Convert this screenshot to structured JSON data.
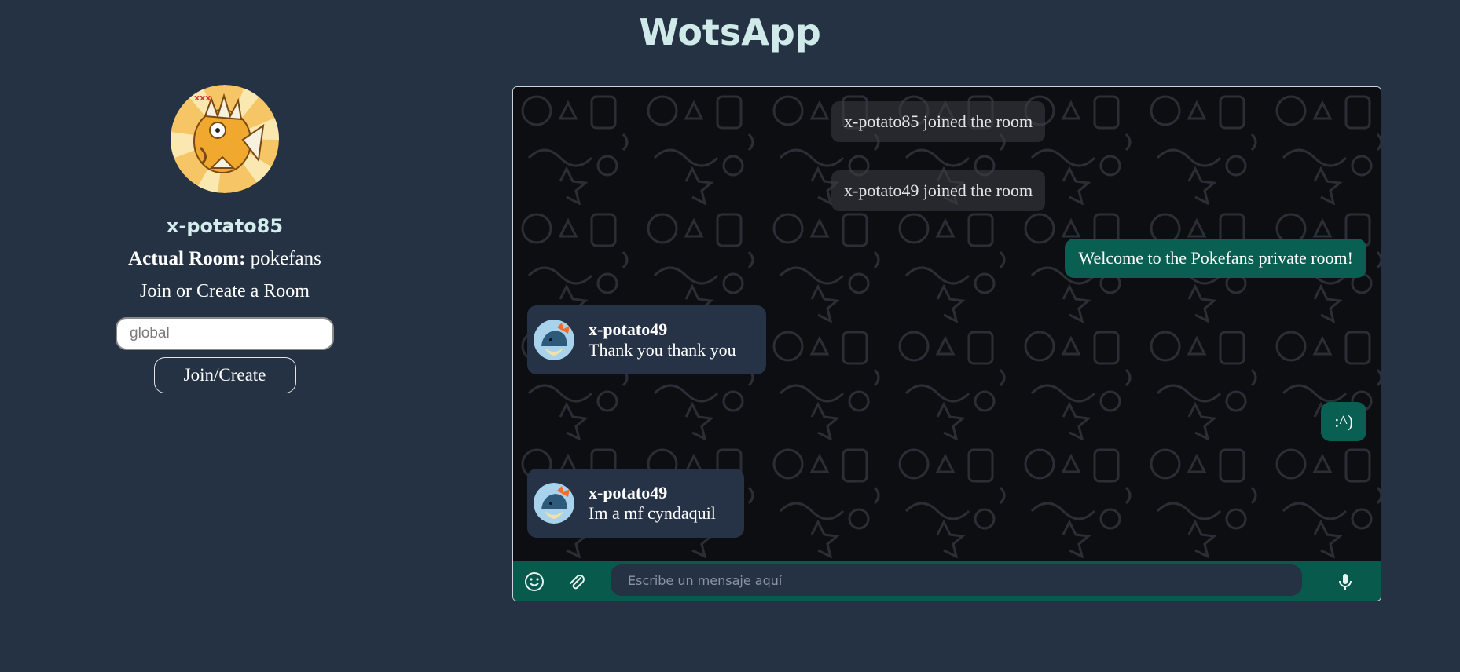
{
  "app": {
    "title": "WotsApp"
  },
  "sidebar": {
    "username": "x-potato85",
    "room_label": "Actual Room:",
    "room_name": "pokefans",
    "join_heading": "Join or Create a Room",
    "room_input_placeholder": "global",
    "room_input_value": "",
    "join_button_label": "Join/Create",
    "avatar_icon": "magikarp-avatar"
  },
  "chat": {
    "system_messages": [
      {
        "text": "x-potato85 joined the room"
      },
      {
        "text": "x-potato49 joined the room"
      }
    ],
    "own_messages": [
      {
        "text": "Welcome to the Pokefans private room!"
      },
      {
        "text": ":^)"
      }
    ],
    "incoming_messages": [
      {
        "author": "x-potato49",
        "text": "Thank you thank you",
        "avatar_icon": "cyndaquil-avatar"
      },
      {
        "author": "x-potato49",
        "text": "Im a mf cyndaquil",
        "avatar_icon": "cyndaquil-avatar"
      }
    ],
    "composer": {
      "placeholder": "Escribe un mensaje aquí",
      "value": "",
      "icons": [
        "emoji-icon",
        "paperclip-icon",
        "microphone-icon"
      ]
    }
  },
  "colors": {
    "page_background": "#253244",
    "title": "#cfeae9",
    "own_bubble": "#0a5f53",
    "incoming_bubble": "#263346",
    "composer_bar": "#085a4d"
  }
}
